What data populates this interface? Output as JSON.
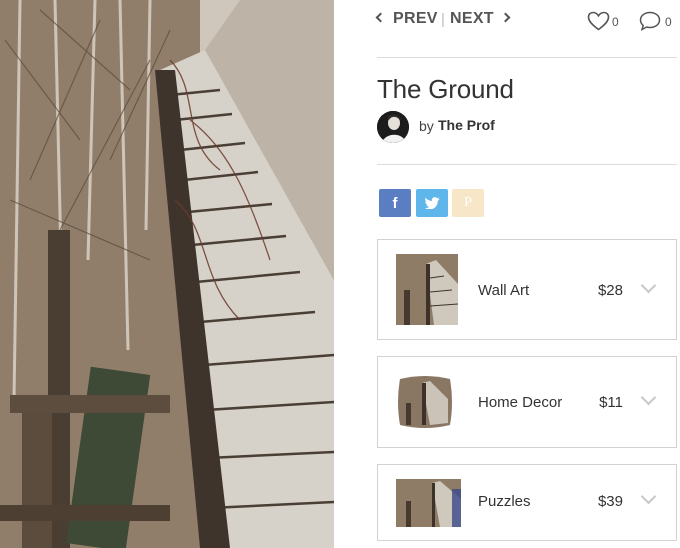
{
  "nav": {
    "prev_label": "PREV",
    "separator": "|",
    "next_label": "NEXT"
  },
  "stats": {
    "likes": "0",
    "comments": "0"
  },
  "artwork": {
    "title": "The Ground",
    "by_label": "by",
    "author": "The Prof"
  },
  "share": {
    "facebook_glyph": "f",
    "twitter_icon": "twitter-bird-icon",
    "pinterest_glyph": "P"
  },
  "products": [
    {
      "name": "Wall Art",
      "price": "$28"
    },
    {
      "name": "Home Decor",
      "price": "$11"
    },
    {
      "name": "Puzzles",
      "price": "$39"
    }
  ],
  "colors": {
    "facebook": "#5b7ec2",
    "twitter": "#5fb6ea",
    "pinterest": "#f7e6c8",
    "divider": "#dcdcdc"
  }
}
